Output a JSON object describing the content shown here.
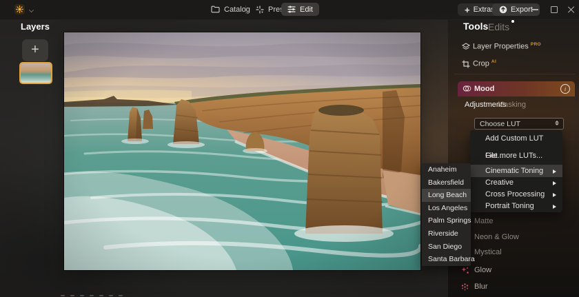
{
  "topbar": {
    "catalog_label": "Catalog",
    "presets_label": "Presets",
    "edit_label": "Edit",
    "extras_label": "Extras",
    "export_label": "Export"
  },
  "icons": {
    "plus": "+"
  },
  "layers_panel": {
    "title": "Layers"
  },
  "right_panel": {
    "tools_tab": "Tools",
    "edits_tab": "Edits",
    "layer_properties": {
      "label": "Layer Properties",
      "badge": "PRO"
    },
    "crop": {
      "label": "Crop",
      "badge": "AI"
    },
    "mood": {
      "title": "Mood",
      "adjustments_tab": "Adjustments",
      "masking_tab": "Masking",
      "lut_dropdown_value": "Choose LUT"
    },
    "tool_items": [
      {
        "label": "Matte"
      },
      {
        "label": "Neon & Glow"
      },
      {
        "label": "Mystical"
      },
      {
        "label": "Glow",
        "icon": "glow-sparkles-icon"
      },
      {
        "label": "Blur",
        "icon": "blur-dots-icon"
      }
    ]
  },
  "lut_menu": {
    "add_custom": "Add Custom LUT File...",
    "get_more": "Get more LUTs...",
    "categories": [
      {
        "label": "Cinematic Toning",
        "highlighted": true,
        "has_submenu": true
      },
      {
        "label": "Creative",
        "has_submenu": true
      },
      {
        "label": "Cross Processing",
        "has_submenu": true
      },
      {
        "label": "Portrait Toning",
        "has_submenu": true
      }
    ]
  },
  "city_submenu": {
    "items": [
      "Anaheim",
      "Bakersfield",
      "Long Beach",
      "Los Angeles",
      "Palm Springs",
      "Riverside",
      "San Diego",
      "Santa Barbara"
    ],
    "highlighted": "Long Beach"
  },
  "colors": {
    "accent_orange": "#E2A33C",
    "badge_orange": "#CF9434",
    "mood_gradient_left": "#69233E",
    "mood_gradient_right": "#7D4A1E",
    "menu_highlight": "#3C3B39",
    "glow_icon_pink": "#E8506A",
    "sea_teal": "#47958A"
  }
}
